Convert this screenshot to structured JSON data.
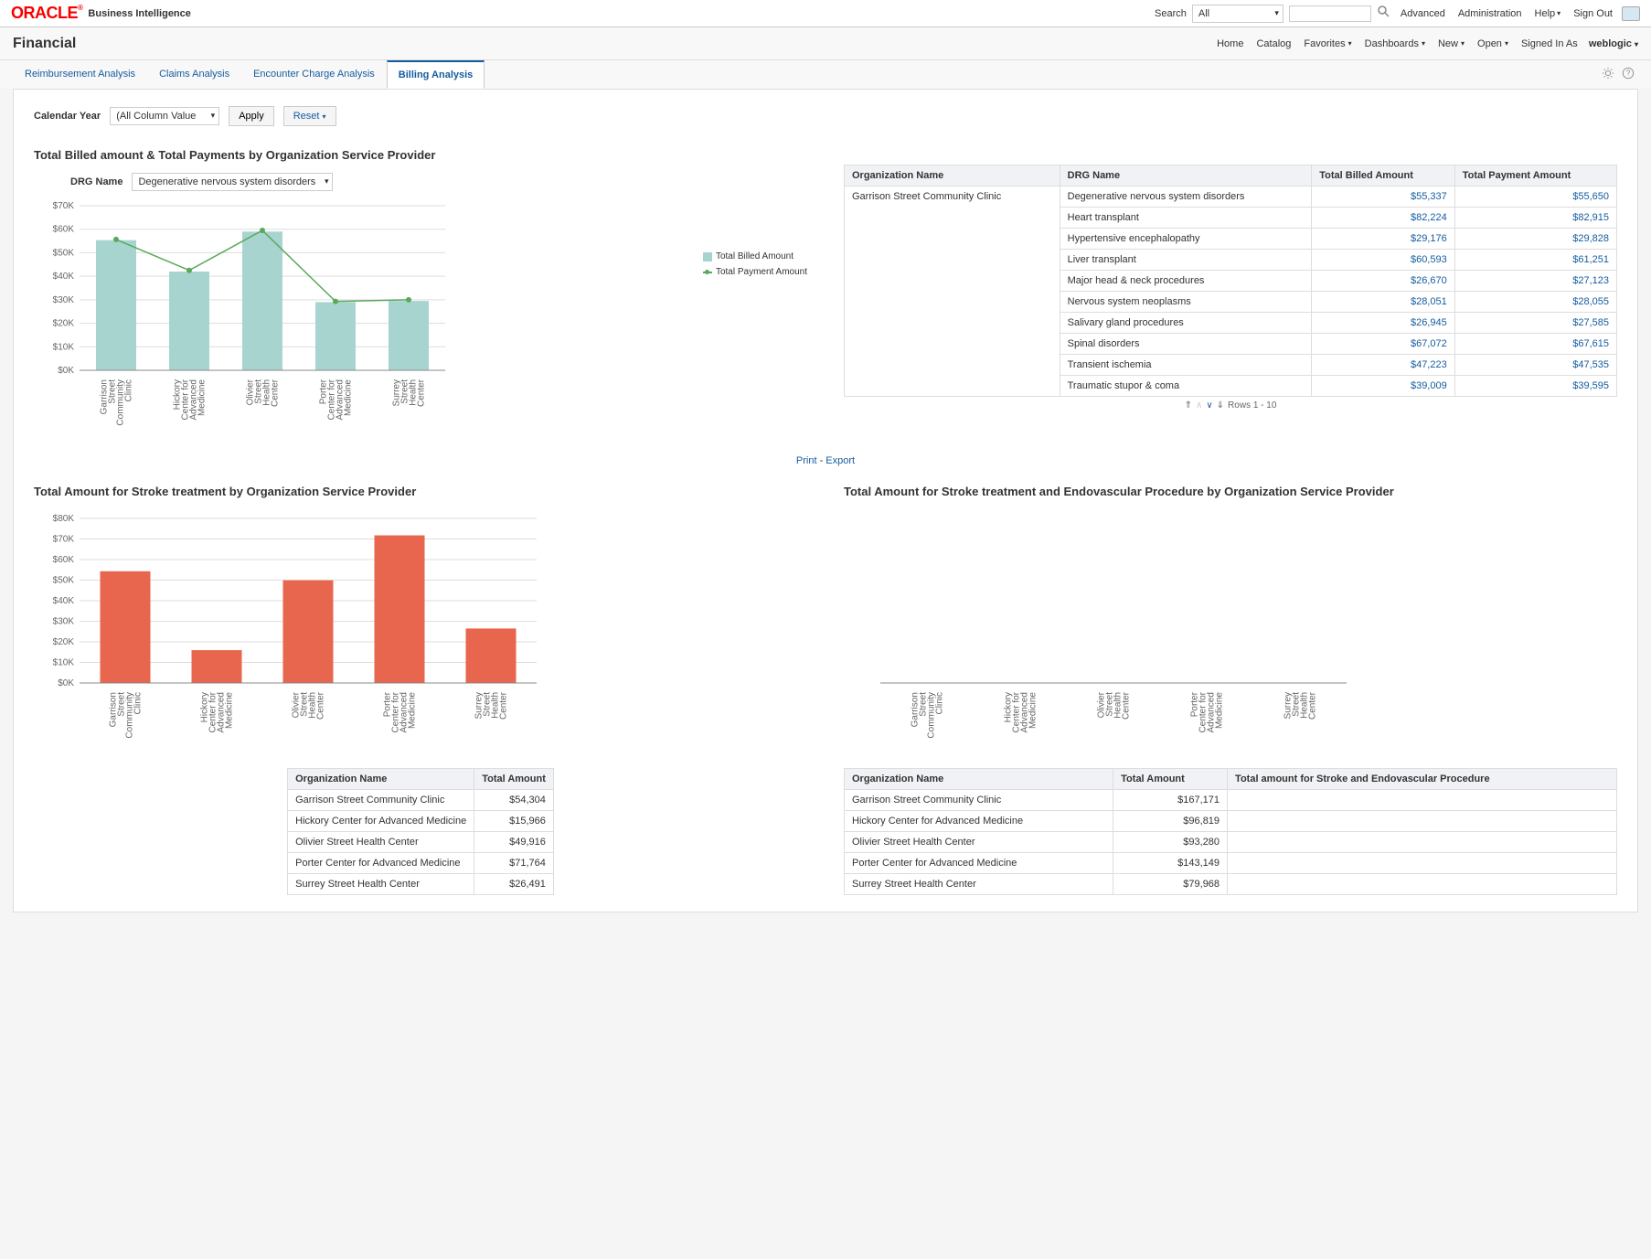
{
  "top": {
    "brand": "ORACLE",
    "brand_sup": "®",
    "suite": "Business Intelligence",
    "search_label": "Search",
    "search_scope": "All",
    "search_placeholder": "",
    "advanced": "Advanced",
    "administration": "Administration",
    "help": "Help",
    "sign_out": "Sign Out"
  },
  "sub": {
    "title": "Financial",
    "home": "Home",
    "catalog": "Catalog",
    "favorites": "Favorites",
    "dashboards": "Dashboards",
    "new": "New",
    "open": "Open",
    "signed_in_as": "Signed In As",
    "user": "weblogic"
  },
  "tabs": {
    "t1": "Reimbursement Analysis",
    "t2": "Claims Analysis",
    "t3": "Encounter Charge Analysis",
    "t4": "Billing Analysis"
  },
  "filter": {
    "label": "Calendar Year",
    "value": "(All Column Value",
    "apply": "Apply",
    "reset": "Reset"
  },
  "panel1": {
    "title": "Total Billed amount & Total Payments by Organization Service Provider",
    "drg_label": "DRG Name",
    "drg_value": "Degenerative nervous system disorders",
    "legend_billed": "Total Billed Amount",
    "legend_payment": "Total Payment Amount"
  },
  "panel1_table": {
    "h1": "Organization Name",
    "h2": "DRG Name",
    "h3": "Total Billed Amount",
    "h4": "Total Payment Amount",
    "org": "Garrison Street Community Clinic",
    "rows": [
      {
        "drg": "Degenerative nervous system disorders",
        "b": "$55,337",
        "p": "$55,650"
      },
      {
        "drg": "Heart transplant",
        "b": "$82,224",
        "p": "$82,915"
      },
      {
        "drg": "Hypertensive encephalopathy",
        "b": "$29,176",
        "p": "$29,828"
      },
      {
        "drg": "Liver transplant",
        "b": "$60,593",
        "p": "$61,251"
      },
      {
        "drg": "Major head & neck procedures",
        "b": "$26,670",
        "p": "$27,123"
      },
      {
        "drg": "Nervous system neoplasms",
        "b": "$28,051",
        "p": "$28,055"
      },
      {
        "drg": "Salivary gland procedures",
        "b": "$26,945",
        "p": "$27,585"
      },
      {
        "drg": "Spinal disorders",
        "b": "$67,072",
        "p": "$67,615"
      },
      {
        "drg": "Transient ischemia",
        "b": "$47,223",
        "p": "$47,535"
      },
      {
        "drg": "Traumatic stupor & coma",
        "b": "$39,009",
        "p": "$39,595"
      }
    ],
    "pager": "Rows 1 - 10"
  },
  "print_export": {
    "print": "Print",
    "dash": " - ",
    "export": "Export"
  },
  "panel2": {
    "title": "Total Amount for Stroke treatment by Organization Service Provider"
  },
  "panel3": {
    "title": "Total Amount for Stroke treatment and Endovascular Procedure by Organization Service Provider"
  },
  "panel2_table": {
    "h1": "Organization Name",
    "h2": "Total Amount",
    "rows": [
      {
        "o": "Garrison Street Community Clinic",
        "a": "$54,304"
      },
      {
        "o": "Hickory Center for Advanced Medicine",
        "a": "$15,966"
      },
      {
        "o": "Olivier Street Health Center",
        "a": "$49,916"
      },
      {
        "o": "Porter Center for Advanced Medicine",
        "a": "$71,764"
      },
      {
        "o": "Surrey Street Health Center",
        "a": "$26,491"
      }
    ]
  },
  "panel3_table": {
    "h1": "Organization Name",
    "h2": "Total Amount",
    "h3": "Total amount for Stroke and Endovascular Procedure",
    "rows": [
      {
        "o": "Garrison Street Community Clinic",
        "a": "$167,171"
      },
      {
        "o": "Hickory Center for Advanced Medicine",
        "a": "$96,819"
      },
      {
        "o": "Olivier Street Health Center",
        "a": "$93,280"
      },
      {
        "o": "Porter Center for Advanced Medicine",
        "a": "$143,149"
      },
      {
        "o": "Surrey Street Health Center",
        "a": "$79,968"
      }
    ]
  },
  "chart_data": [
    {
      "type": "bar",
      "title": "Total Billed amount & Total Payments by Organization Service Provider",
      "categories": [
        "Garrison Street Community Clinic",
        "Hickory Center for Advanced Medicine",
        "Olivier Street Health Center",
        "Porter Center for Advanced Medicine",
        "Surrey Street Health Center"
      ],
      "series": [
        {
          "name": "Total Billed Amount",
          "values": [
            55337,
            42000,
            59000,
            29000,
            29500
          ]
        },
        {
          "name": "Total Payment Amount",
          "values": [
            55650,
            42500,
            59500,
            29300,
            30000
          ]
        }
      ],
      "ylim": [
        0,
        70000
      ],
      "ylabel": "",
      "xlabel": ""
    },
    {
      "type": "bar",
      "title": "Total Amount for Stroke treatment by Organization Service Provider",
      "categories": [
        "Garrison Street Community Clinic",
        "Hickory Center for Advanced Medicine",
        "Olivier Street Health Center",
        "Porter Center for Advanced Medicine",
        "Surrey Street Health Center"
      ],
      "values": [
        54304,
        15966,
        49916,
        71764,
        26491
      ],
      "ylim": [
        0,
        80000
      ],
      "ylabel": "",
      "xlabel": ""
    },
    {
      "type": "bar",
      "title": "Total Amount for Stroke treatment and Endovascular Procedure by Organization Service Provider",
      "categories": [
        "Garrison Street Community Clinic",
        "Hickory Center for Advanced Medicine",
        "Olivier Street Health Center",
        "Porter Center for Advanced Medicine",
        "Surrey Street Health Center"
      ],
      "values": [],
      "ylim": [
        0,
        0
      ],
      "ylabel": "",
      "xlabel": ""
    }
  ],
  "axis": {
    "c1y": [
      "$0K",
      "$10K",
      "$20K",
      "$30K",
      "$40K",
      "$50K",
      "$60K",
      "$70K"
    ],
    "c2y": [
      "$0K",
      "$10K",
      "$20K",
      "$30K",
      "$40K",
      "$50K",
      "$60K",
      "$70K",
      "$80K"
    ],
    "xcats_short": [
      "Garrison Street Community Clinic",
      "Hickory Center for Advanced Medicine",
      "Olivier Street Health Center",
      "Porter Center for Advanced Medicine",
      "Surrey Street Health Center"
    ]
  }
}
